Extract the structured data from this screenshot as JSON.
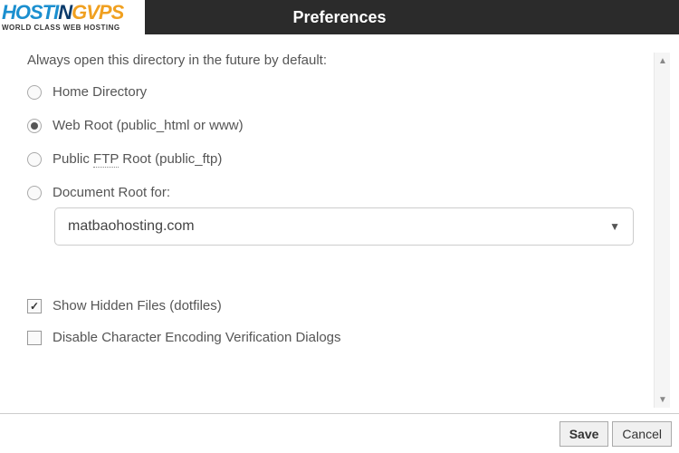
{
  "logo": {
    "part1": "HOSTI",
    "part2": "N",
    "part3": "G",
    "part4": "VPS",
    "sub": "WORLD CLASS WEB HOSTING"
  },
  "header": {
    "title": "Preferences"
  },
  "directory": {
    "prompt": "Always open this directory in the future by default:",
    "options": {
      "home": "Home Directory",
      "webroot": "Web Root (public_html or www)",
      "ftp_pre": "Public ",
      "ftp_mid": "FTP",
      "ftp_post": " Root (public_ftp)",
      "docroot": "Document Root for:"
    },
    "selected": "webroot",
    "docroot_value": "matbaohosting.com"
  },
  "checks": {
    "hidden": {
      "label": "Show Hidden Files (dotfiles)",
      "checked": true
    },
    "encoding": {
      "label": "Disable Character Encoding Verification Dialogs",
      "checked": false
    }
  },
  "footer": {
    "save": "Save",
    "cancel": "Cancel"
  }
}
